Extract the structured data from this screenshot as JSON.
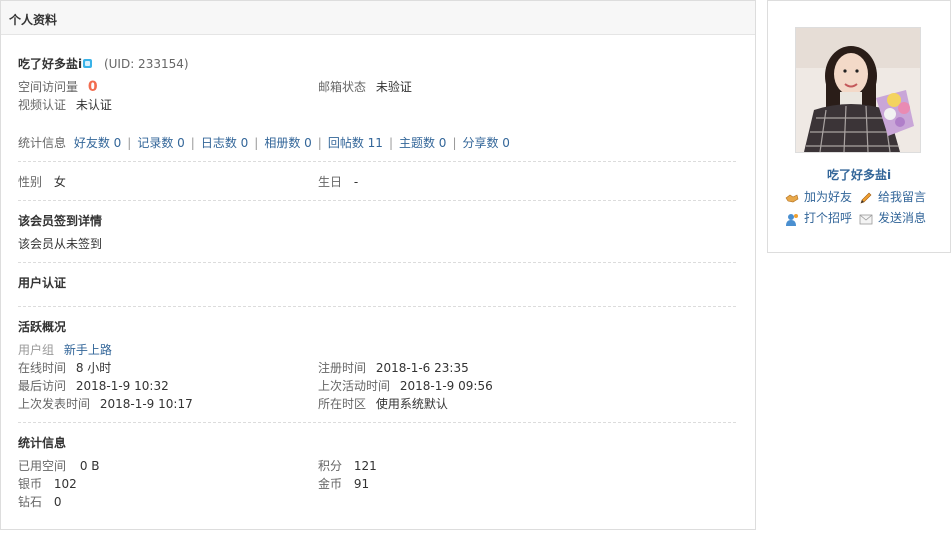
{
  "header": {
    "title": "个人资料"
  },
  "profile": {
    "username": "吃了好多盐i",
    "uid": "(UID: 233154)",
    "visits_label": "空间访问量",
    "visits_value": "0",
    "email_label": "邮箱状态",
    "email_value": "未验证",
    "video_label": "视频认证",
    "video_value": "未认证"
  },
  "stats_links": {
    "label": "统计信息",
    "items": [
      {
        "label": "好友数 0"
      },
      {
        "label": "记录数 0"
      },
      {
        "label": "日志数 0"
      },
      {
        "label": "相册数 0"
      },
      {
        "label": "回帖数 11"
      },
      {
        "label": "主题数 0"
      },
      {
        "label": "分享数 0"
      }
    ]
  },
  "basic": {
    "gender_label": "性别",
    "gender_value": "女",
    "birthday_label": "生日",
    "birthday_value": "-"
  },
  "checkin": {
    "title": "该会员签到详情",
    "text": "该会员从未签到"
  },
  "verify": {
    "title": "用户认证"
  },
  "activity": {
    "title": "活跃概况",
    "group_label": "用户组",
    "group_value": "新手上路",
    "online_label": "在线时间",
    "online_value": "8 小时",
    "register_label": "注册时间",
    "register_value": "2018-1-6 23:35",
    "last_visit_label": "最后访问",
    "last_visit_value": "2018-1-9 10:32",
    "last_active_label": "上次活动时间",
    "last_active_value": "2018-1-9 09:56",
    "last_post_label": "上次发表时间",
    "last_post_value": "2018-1-9 10:17",
    "timezone_label": "所在时区",
    "timezone_value": "使用系统默认"
  },
  "statistics": {
    "title": "统计信息",
    "space_label": "已用空间",
    "space_value": "0 B",
    "points_label": "积分",
    "points_value": "121",
    "silver_label": "银币",
    "silver_value": "102",
    "gold_label": "金币",
    "gold_value": "91",
    "diamond_label": "钻石",
    "diamond_value": "0"
  },
  "sidebar": {
    "username": "吃了好多盐i",
    "avatar_icon": "user-photo",
    "actions": [
      {
        "label": "加为好友",
        "icon": "handshake-icon"
      },
      {
        "label": "给我留言",
        "icon": "pencil-icon"
      },
      {
        "label": "打个招呼",
        "icon": "greet-user-icon"
      },
      {
        "label": "发送消息",
        "icon": "envelope-icon"
      }
    ]
  },
  "colors": {
    "link": "#336699",
    "accent": "#f26c4f",
    "header_bg": "#f7f7f7",
    "border": "#dddddd"
  }
}
